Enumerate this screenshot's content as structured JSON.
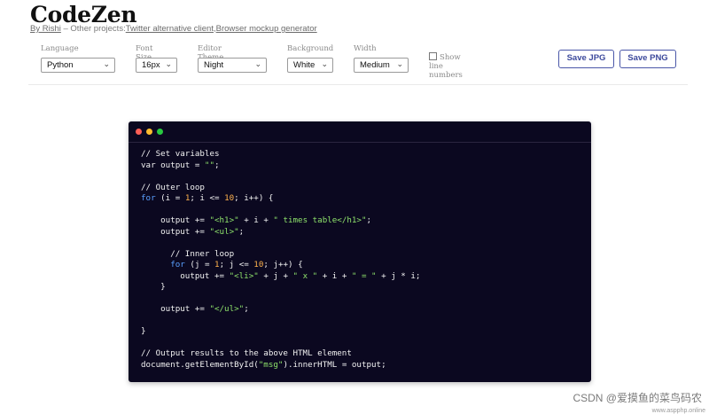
{
  "header": {
    "title": "CodeZen",
    "by_label": "By Rishi",
    "separator": " – Other projects:",
    "projects": [
      "Twitter alternative client",
      "Browser mockup generator"
    ],
    "project_sep": ","
  },
  "controls": {
    "language": {
      "label": "Language",
      "value": "Python"
    },
    "font_size": {
      "label": "Font Size",
      "value": "16px"
    },
    "theme": {
      "label": "Editor Theme",
      "value": "Night"
    },
    "background": {
      "label": "Background",
      "value": "White"
    },
    "width": {
      "label": "Width",
      "value": "Medium"
    },
    "line_numbers": {
      "label": "Show line numbers",
      "checked": false
    },
    "save_jpg": "Save JPG",
    "save_png": "Save PNG"
  },
  "editor": {
    "colors": {
      "background": "#0b0820",
      "keyword": "#5aa0ff",
      "string": "#8ee26b",
      "number": "#ffb24d",
      "text": "#f2f2f2"
    },
    "lines": [
      [
        {
          "t": "// Set variables"
        }
      ],
      [
        {
          "t": "var output = "
        },
        {
          "t": "\"\"",
          "c": "str"
        },
        {
          "t": ";"
        }
      ],
      [],
      [
        {
          "t": "// Outer loop"
        }
      ],
      [
        {
          "t": "for",
          "c": "kw"
        },
        {
          "t": " (i = "
        },
        {
          "t": "1",
          "c": "num"
        },
        {
          "t": "; i <= "
        },
        {
          "t": "10",
          "c": "num"
        },
        {
          "t": "; i++) {"
        }
      ],
      [],
      [
        {
          "t": "    output += "
        },
        {
          "t": "\"<h1>\"",
          "c": "str"
        },
        {
          "t": " + i + "
        },
        {
          "t": "\" times table</h1>\"",
          "c": "str"
        },
        {
          "t": ";"
        }
      ],
      [
        {
          "t": "    output += "
        },
        {
          "t": "\"<ul>\"",
          "c": "str"
        },
        {
          "t": ";"
        }
      ],
      [],
      [
        {
          "t": "      // Inner loop"
        }
      ],
      [
        {
          "t": "      "
        },
        {
          "t": "for",
          "c": "kw"
        },
        {
          "t": " (j = "
        },
        {
          "t": "1",
          "c": "num"
        },
        {
          "t": "; j <= "
        },
        {
          "t": "10",
          "c": "num"
        },
        {
          "t": "; j++) {"
        }
      ],
      [
        {
          "t": "        output += "
        },
        {
          "t": "\"<li>\"",
          "c": "str"
        },
        {
          "t": " + j + "
        },
        {
          "t": "\" x \"",
          "c": "str"
        },
        {
          "t": " + i + "
        },
        {
          "t": "\" = \"",
          "c": "str"
        },
        {
          "t": " + j * i;"
        }
      ],
      [
        {
          "t": "    }"
        }
      ],
      [],
      [
        {
          "t": "    output += "
        },
        {
          "t": "\"</ul>\"",
          "c": "str"
        },
        {
          "t": ";"
        }
      ],
      [],
      [
        {
          "t": "}"
        }
      ],
      [],
      [
        {
          "t": "// Output results to the above HTML element"
        }
      ],
      [
        {
          "t": "document.getElementById("
        },
        {
          "t": "\"msg\"",
          "c": "str"
        },
        {
          "t": ").innerHTML = output;"
        }
      ]
    ]
  },
  "watermark": {
    "main": "CSDN @爱摸鱼的菜鸟码农",
    "sub": "www.aspphp.online"
  }
}
